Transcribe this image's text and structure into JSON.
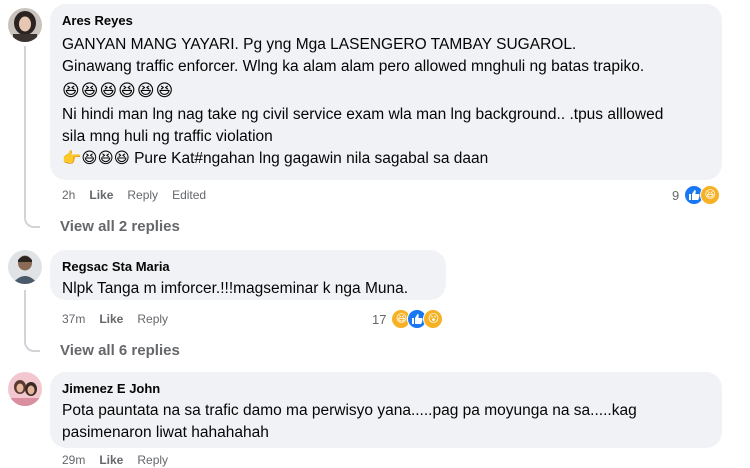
{
  "comments": [
    {
      "author": "Ares Reyes",
      "lines": [
        "GANYAN MANG YAYARI. Pg yng Mga LASENGERO TAMBAY SUGAROL.",
        "Ginawang traffic enforcer. Wlng ka alam alam pero allowed mnghuli ng batas trapiko.",
        "😆😆😆😆😆😆",
        "Ni hindi man lng nag take ng civil service exam wla man lng background.. .tpus alllowed",
        "sila mng huli ng traffic violation",
        "👉😆😆😆 Pure Kat#ngahan lng gagawin nila sagabal sa daan"
      ],
      "time": "2h",
      "like_label": "Like",
      "reply_label": "Reply",
      "edited_label": "Edited",
      "reaction_count": "9",
      "view_replies": "View all 2 replies"
    },
    {
      "author": "Regsac Sta Maria",
      "lines": [
        "Nlpk Tanga m imforcer.!!!magseminar k nga Muna."
      ],
      "time": "37m",
      "like_label": "Like",
      "reply_label": "Reply",
      "reaction_count": "17",
      "view_replies": "View all 6 replies"
    },
    {
      "author": "Jimenez E John",
      "lines": [
        "Pota pauntata na sa trafic damo ma perwisyo yana.....pag pa moyunga na sa.....kag",
        "pasimenaron liwat hahahahah"
      ],
      "time": "29m",
      "like_label": "Like",
      "reply_label": "Reply"
    }
  ],
  "icons": {
    "like_glyph": "👍",
    "haha_glyph": "😆",
    "wow_glyph": "😮"
  }
}
